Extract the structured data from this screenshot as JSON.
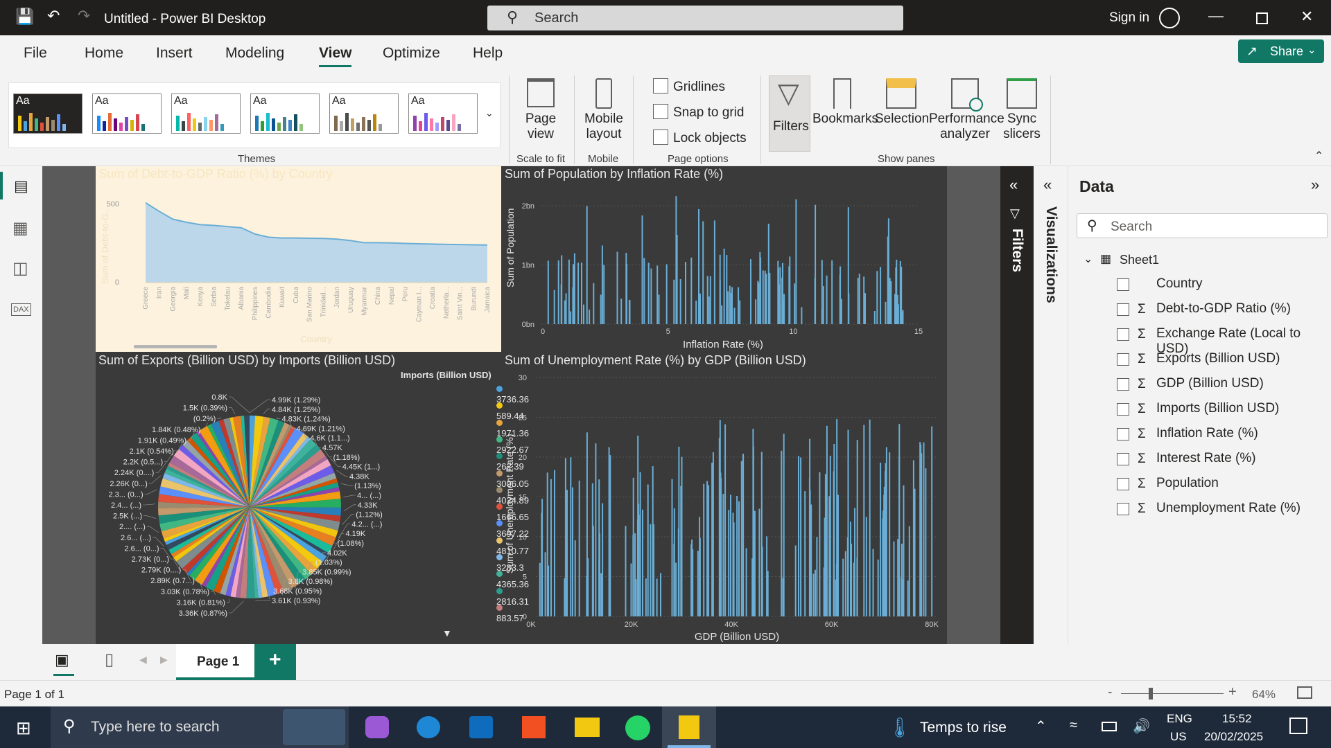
{
  "app": {
    "title": "Untitled - Power BI Desktop",
    "search_placeholder": "Search",
    "sign_in": "Sign in",
    "share": "Share"
  },
  "menu": [
    "File",
    "Home",
    "Insert",
    "Modeling",
    "View",
    "Optimize",
    "Help"
  ],
  "ribbon": {
    "themes_label": "Themes",
    "theme_aa": "Aa",
    "page_view": [
      "Page",
      "view"
    ],
    "scale_to_fit": "Scale to fit",
    "mobile_layout": [
      "Mobile",
      "layout"
    ],
    "mobile": "Mobile",
    "page_options": {
      "gridlines": "Gridlines",
      "snap": "Snap to grid",
      "lock": "Lock objects",
      "label": "Page options"
    },
    "show_panes": {
      "filters": "Filters",
      "bookmarks": "Bookmarks",
      "selection": "Selection",
      "performance": [
        "Performance",
        "analyzer"
      ],
      "sync": [
        "Sync",
        "slicers"
      ],
      "label": "Show panes"
    }
  },
  "visuals": {
    "v1": {
      "title": "Sum of Debt-to-GDP Ratio (%) by Country",
      "ylabel": "Sum of Debt-to-G...",
      "xlabel": "Country",
      "ymax_tick": "500",
      "ymin_tick": "0"
    },
    "v2": {
      "title": "Sum of Population by Inflation Rate (%)",
      "ylabel": "Sum of Population",
      "xlabel": "Inflation Rate (%)"
    },
    "v3": {
      "title": "Sum of Exports (Billion USD) by Imports (Billion USD)",
      "legend_title": "Imports (Billion USD)"
    },
    "v4": {
      "title": "Sum of Unemployment Rate (%) by GDP (Billion USD)",
      "ylabel": "Sum of Unemployment Rate (%)",
      "xlabel": "GDP (Billion USD)"
    }
  },
  "chart_data": [
    {
      "type": "area",
      "title": "Sum of Debt-to-GDP Ratio (%) by Country",
      "xlabel": "Country",
      "ylabel": "Sum of Debt-to-G...",
      "ylim": [
        0,
        500
      ],
      "ticks_y": [
        "0",
        "500"
      ],
      "categories": [
        "Greece",
        "Iran",
        "Georgia",
        "Mali",
        "Kenya",
        "Serbia",
        "Tokelau",
        "Albania",
        "Philippines",
        "Cambodia",
        "Kuwait",
        "Cuba",
        "San Marino",
        "Trinidad...",
        "Jordan",
        "Uruguay",
        "Myanmar",
        "China",
        "Nepal",
        "Peru",
        "Cayman I...",
        "Croatia",
        "Netherla...",
        "Saint Vin...",
        "Burundi",
        "Jamaica"
      ],
      "values": [
        510,
        455,
        405,
        385,
        370,
        365,
        358,
        350,
        310,
        290,
        285,
        285,
        283,
        282,
        278,
        268,
        255,
        255,
        253,
        250,
        248,
        246,
        244,
        243,
        241,
        240
      ]
    },
    {
      "type": "bar",
      "title": "Sum of Population by Inflation Rate (%)",
      "xlabel": "Inflation Rate (%)",
      "ylabel": "Sum of Population",
      "ticks_x": [
        "0",
        "5",
        "10",
        "15"
      ],
      "ticks_y": [
        "0bn",
        "1bn",
        "2bn"
      ],
      "xlim": [
        0,
        15
      ],
      "ylim": [
        0,
        2.2
      ]
    },
    {
      "type": "pie",
      "title": "Sum of Exports (Billion USD) by Imports (Billion USD)",
      "legend_title": "Imports (Billion USD)",
      "legend": [
        "3736.36",
        "589.44",
        "1971.36",
        "2922.67",
        "262.39",
        "3006.05",
        "4024.89",
        "1666.65",
        "3697.22",
        "4810.77",
        "3283.3",
        "4365.36",
        "2816.31",
        "883.57"
      ],
      "legend_colors": [
        "#4aa3df",
        "#f2c811",
        "#e8a33d",
        "#41b883",
        "#1a8f7a",
        "#c49a6c",
        "#9b8b6e",
        "#e0523a",
        "#5b8ff9",
        "#e9c46a",
        "#7fb8e8",
        "#3fb29b",
        "#2a9d8f",
        "#c47e7e"
      ],
      "labels_right": [
        "4.99K (1.29%)",
        "4.84K (1.25%)",
        "4.83K (1.24%)",
        "4.69K (1.21%)",
        "4.6K (1.1...)",
        "4.57K",
        "(1.18%)",
        "4.45K (1...)",
        "4.38K",
        "(1.13%)",
        "4... (...)",
        "4.33K",
        "(1.12%)",
        "4.2... (...)",
        "4.19K",
        "(1.08%)",
        "4.02K",
        "(1.03%)",
        "3.85K (0.99%)",
        "3.8K (0.98%)",
        "3.68K (0.95%)",
        "3.61K (0.93%)"
      ],
      "labels_left": [
        "0.8K",
        "1.5K (0.39%)",
        "(0.2%)",
        "1.84K (0.48%)",
        "1.91K (0.49%)",
        "2.1K (0.54%)",
        "2.2K (0.5...)",
        "2.24K (0....)",
        "2.26K (0...)",
        "2.3... (0...)",
        "2.4... (...)",
        "2.5K (...)",
        "2.... (...)",
        "2.6... (...)",
        "2.6... (0...)",
        "2.73K (0...)",
        "2.79K (0....)",
        "2.89K (0.7...)",
        "3.03K (0.78%)",
        "3.16K (0.81%)",
        "3.36K (0.87%)"
      ]
    },
    {
      "type": "bar",
      "title": "Sum of Unemployment Rate (%) by GDP (Billion USD)",
      "xlabel": "GDP (Billion USD)",
      "ylabel": "Sum of Unemployment Rate (%)",
      "ticks_x": [
        "0K",
        "20K",
        "40K",
        "60K",
        "80K"
      ],
      "ticks_y": [
        "0",
        "5",
        "10",
        "15",
        "20",
        "25",
        "30"
      ],
      "xlim": [
        0,
        80000
      ],
      "ylim": [
        0,
        30
      ]
    }
  ],
  "panes": {
    "filters": "Filters",
    "visualizations": "Visualizations",
    "data_title": "Data",
    "data_search": "Search",
    "table": "Sheet1",
    "fields": [
      {
        "name": "Country",
        "sigma": false
      },
      {
        "name": "Debt-to-GDP Ratio (%)",
        "sigma": true
      },
      {
        "name": "Exchange Rate (Local to USD)",
        "sigma": true
      },
      {
        "name": "Exports (Billion USD)",
        "sigma": true
      },
      {
        "name": "GDP (Billion USD)",
        "sigma": true
      },
      {
        "name": "Imports (Billion USD)",
        "sigma": true
      },
      {
        "name": "Inflation Rate (%)",
        "sigma": true
      },
      {
        "name": "Interest Rate (%)",
        "sigma": true
      },
      {
        "name": "Population",
        "sigma": true
      },
      {
        "name": "Unemployment Rate (%)",
        "sigma": true
      }
    ],
    "sigma": "Σ"
  },
  "pages": {
    "tab": "Page 1",
    "add": "+"
  },
  "status": {
    "page": "Page 1 of 1",
    "zoom": "64%",
    "minus": "-",
    "plus": "+"
  },
  "taskbar": {
    "search": "Type here to search",
    "weather": "Temps to rise",
    "lang1": "ENG",
    "lang2": "US",
    "time": "15:52",
    "date": "20/02/2025"
  }
}
